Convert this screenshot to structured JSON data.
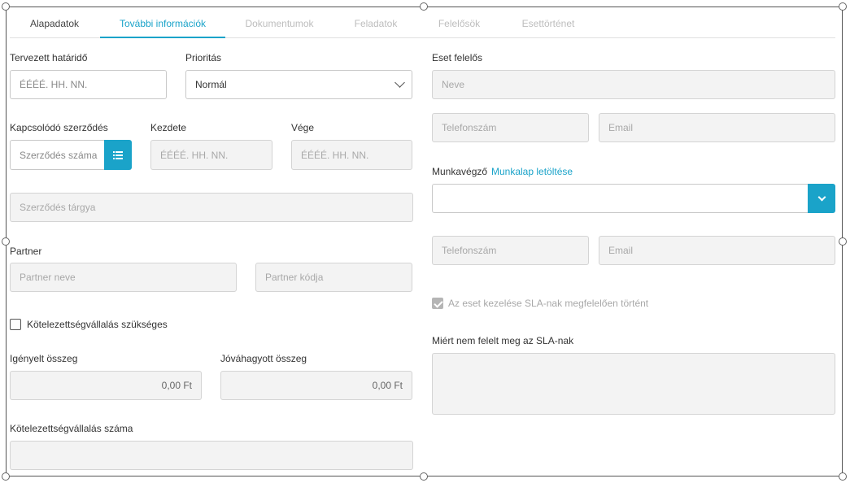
{
  "tabs": [
    {
      "label": "Alapadatok",
      "state": "done"
    },
    {
      "label": "További információk",
      "state": "active"
    },
    {
      "label": "Dokumentumok",
      "state": "disabled"
    },
    {
      "label": "Feladatok",
      "state": "disabled"
    },
    {
      "label": "Felelősök",
      "state": "disabled"
    },
    {
      "label": "Esettörténet",
      "state": "disabled"
    }
  ],
  "left": {
    "deadline": {
      "label": "Tervezett határidő",
      "placeholder": "ÉÉÉÉ. HH. NN."
    },
    "priority": {
      "label": "Prioritás",
      "value": "Normál"
    },
    "contract": {
      "label": "Kapcsolódó szerződés",
      "placeholder": "Szerződés száma",
      "list_icon": "list-icon"
    },
    "start": {
      "label": "Kezdete",
      "placeholder": "ÉÉÉÉ. HH. NN."
    },
    "end": {
      "label": "Vége",
      "placeholder": "ÉÉÉÉ. HH. NN."
    },
    "contract_subject": {
      "placeholder": "Szerződés tárgya"
    },
    "partner": {
      "label": "Partner",
      "name_placeholder": "Partner neve",
      "code_placeholder": "Partner kódja"
    },
    "commitment_required": {
      "label": "Kötelezettségvállalás szükséges",
      "checked": false
    },
    "requested_amount": {
      "label": "Igényelt összeg",
      "value": "0,00 Ft"
    },
    "approved_amount": {
      "label": "Jóváhagyott összeg",
      "value": "0,00 Ft"
    },
    "commitment_number": {
      "label": "Kötelezettségvállalás száma",
      "value": ""
    }
  },
  "right": {
    "case_owner": {
      "label": "Eset felelős",
      "name_placeholder": "Neve",
      "phone_placeholder": "Telefonszám",
      "email_placeholder": "Email"
    },
    "worker": {
      "label": "Munkavégző",
      "link": "Munkalap letöltése",
      "value": "",
      "phone_placeholder": "Telefonszám",
      "email_placeholder": "Email"
    },
    "sla": {
      "label": "Az eset kezelése SLA-nak megfelelően történt",
      "checked": true
    },
    "sla_reason": {
      "label": "Miért nem felelt meg az SLA-nak",
      "value": ""
    }
  },
  "colors": {
    "accent": "#1aa3c9",
    "disabled_bg": "#f3f3f3"
  }
}
